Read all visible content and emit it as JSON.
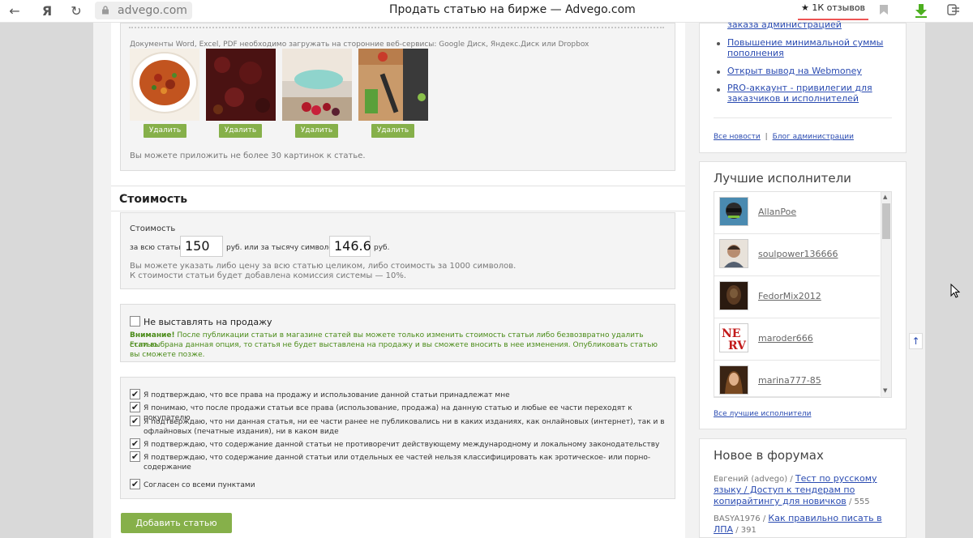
{
  "browser": {
    "site_address": "advego.com",
    "page_title": "Продать статью на бирже — Advego.com",
    "reviews_badge": "★ 1К отзывов"
  },
  "upload": {
    "docs_note": "Документы Word, Excel, PDF необходимо загружать на сторонние веб-сервисы: Google Диск, Яндекс.Диск или Dropbox",
    "delete_label": "Удалить",
    "images_limit_note": "Вы можете приложить не более 30 картинок к статье."
  },
  "price": {
    "section_title": "Стоимость",
    "label": "Стоимость",
    "whole_label": "за всю статью",
    "whole_value": "150",
    "per_thousand_label": "руб. или за тысячу символов",
    "per_thousand_value": "146.6",
    "currency": "руб.",
    "hint_line1": "Вы можете указать либо цену за всю статью целиком, либо стоимость за 1000 символов.",
    "hint_line2": "К стоимости статьи будет добавлена комиссия системы — 10%."
  },
  "no_sale": {
    "label": "Не выставлять на продажу",
    "warning_bold": "Внимание!",
    "warning_text": " После публикации статьи в магазине статей вы можете только изменить стоимость статьи либо безвозвратно удалить статью.",
    "warning_text2": "Если выбрана данная опция, то статья не будет выставлена на продажу и вы сможете вносить в нее изменения. Опубликовать статью вы сможете позже."
  },
  "confirmations": [
    {
      "text": "Я подтверждаю, что все права на продажу и использование данной статьи принадлежат мне",
      "checked": true
    },
    {
      "text": "Я понимаю, что после продажи статьи все права (использование, продажа) на данную статью и любые ее части переходят к покупателю",
      "checked": true
    },
    {
      "text": "Я подтверждаю, что ни данная статья, ни ее части ранее не публиковались ни в каких изданиях, как онлайновых (интернет), так и в офлайновых (печатные издания), ни в каком виде",
      "checked": true
    },
    {
      "text": "Я подтверждаю, что содержание данной статьи не противоречит действующему международному и локальному законодательству",
      "checked": true
    },
    {
      "text": "Я подтверждаю, что содержание данной статьи или отдельных ее частей нельзя классифицировать как эротическое- или порно- содержание",
      "checked": true
    }
  ],
  "agree_all": {
    "label": "Согласен со всеми пунктами",
    "checked": true
  },
  "add_article_button": "Добавить статью",
  "news": {
    "items": [
      "заказа администрацией",
      "Повышение минимальной суммы пополнения",
      "Открыт вывод на Webmoney",
      "PRO-аккаунт - привилегии для заказчиков и исполнителей"
    ],
    "all_news": "Все новости",
    "separator": "|",
    "admin_blog": "Блог администрации"
  },
  "performers": {
    "title": "Лучшие исполнители",
    "list": [
      "AllanPoe",
      "soulpower136666",
      "FedorMix2012",
      "maroder666",
      "marina777-85"
    ],
    "all_link": "Все лучшие исполнители"
  },
  "forums": {
    "title": "Новое в форумах",
    "posts": [
      {
        "author": "Евгений (advego)",
        "sep": " / ",
        "topic": "Тест по русскому языку / Доступ к тендерам по копирайтингу для новичков",
        "count": " / 555"
      },
      {
        "author": "BASYA1976",
        "sep": " / ",
        "topic": "Как правильно писать в ЛПА",
        "count": " / 391"
      }
    ]
  },
  "colors": {
    "accent_green": "#86b04a",
    "link_blue": "#2a4bb1"
  }
}
